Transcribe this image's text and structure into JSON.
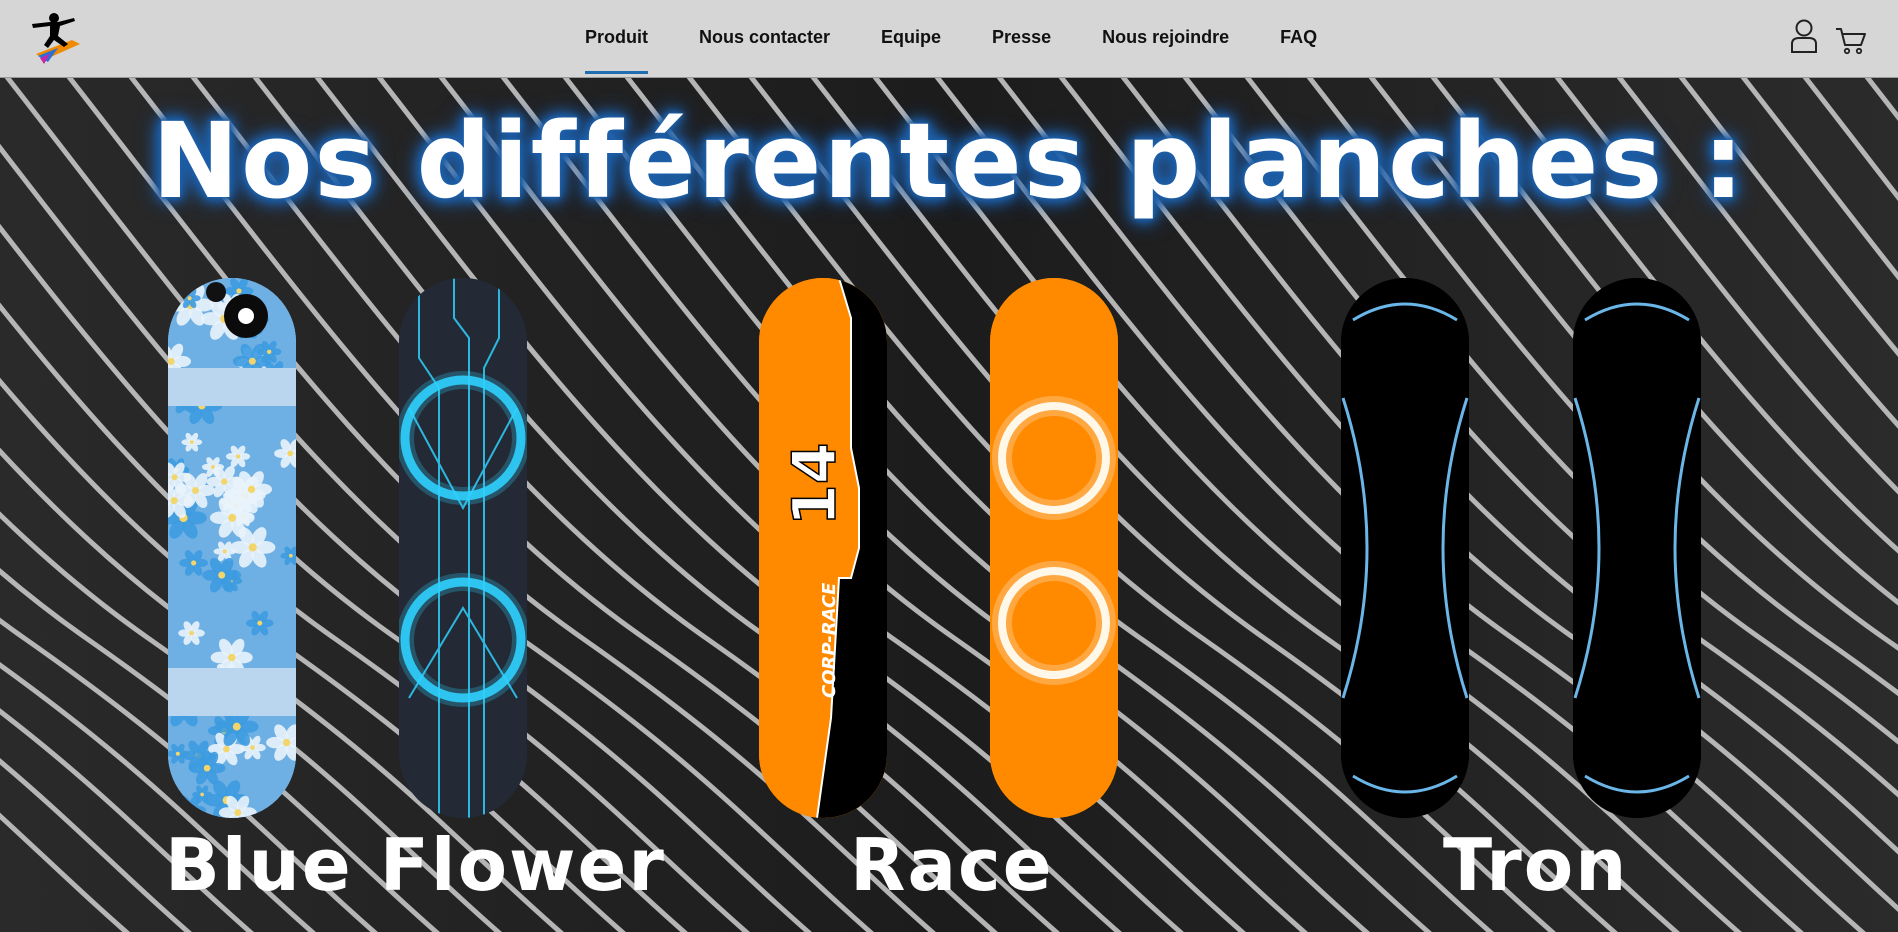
{
  "nav": {
    "items": [
      "Produit",
      "Nous contacter",
      "Equipe",
      "Presse",
      "Nous rejoindre",
      "FAQ"
    ],
    "active": "Produit"
  },
  "icons": {
    "logo": "skater-logo-icon",
    "account": "user-icon",
    "cart": "cart-icon"
  },
  "hero": {
    "title": "Nos différentes planches :",
    "collections": [
      {
        "name": "Blue Flower"
      },
      {
        "name": "Race"
      },
      {
        "name": "Tron"
      }
    ]
  },
  "colors": {
    "header_bg": "#d6d6d6",
    "nav_underline": "#1f6fb0",
    "title_glow": "#1d5fa8",
    "race_orange": "#ff8a00",
    "tron_line": "#6bb6e8",
    "flower_blue": "#5aa8e6"
  }
}
